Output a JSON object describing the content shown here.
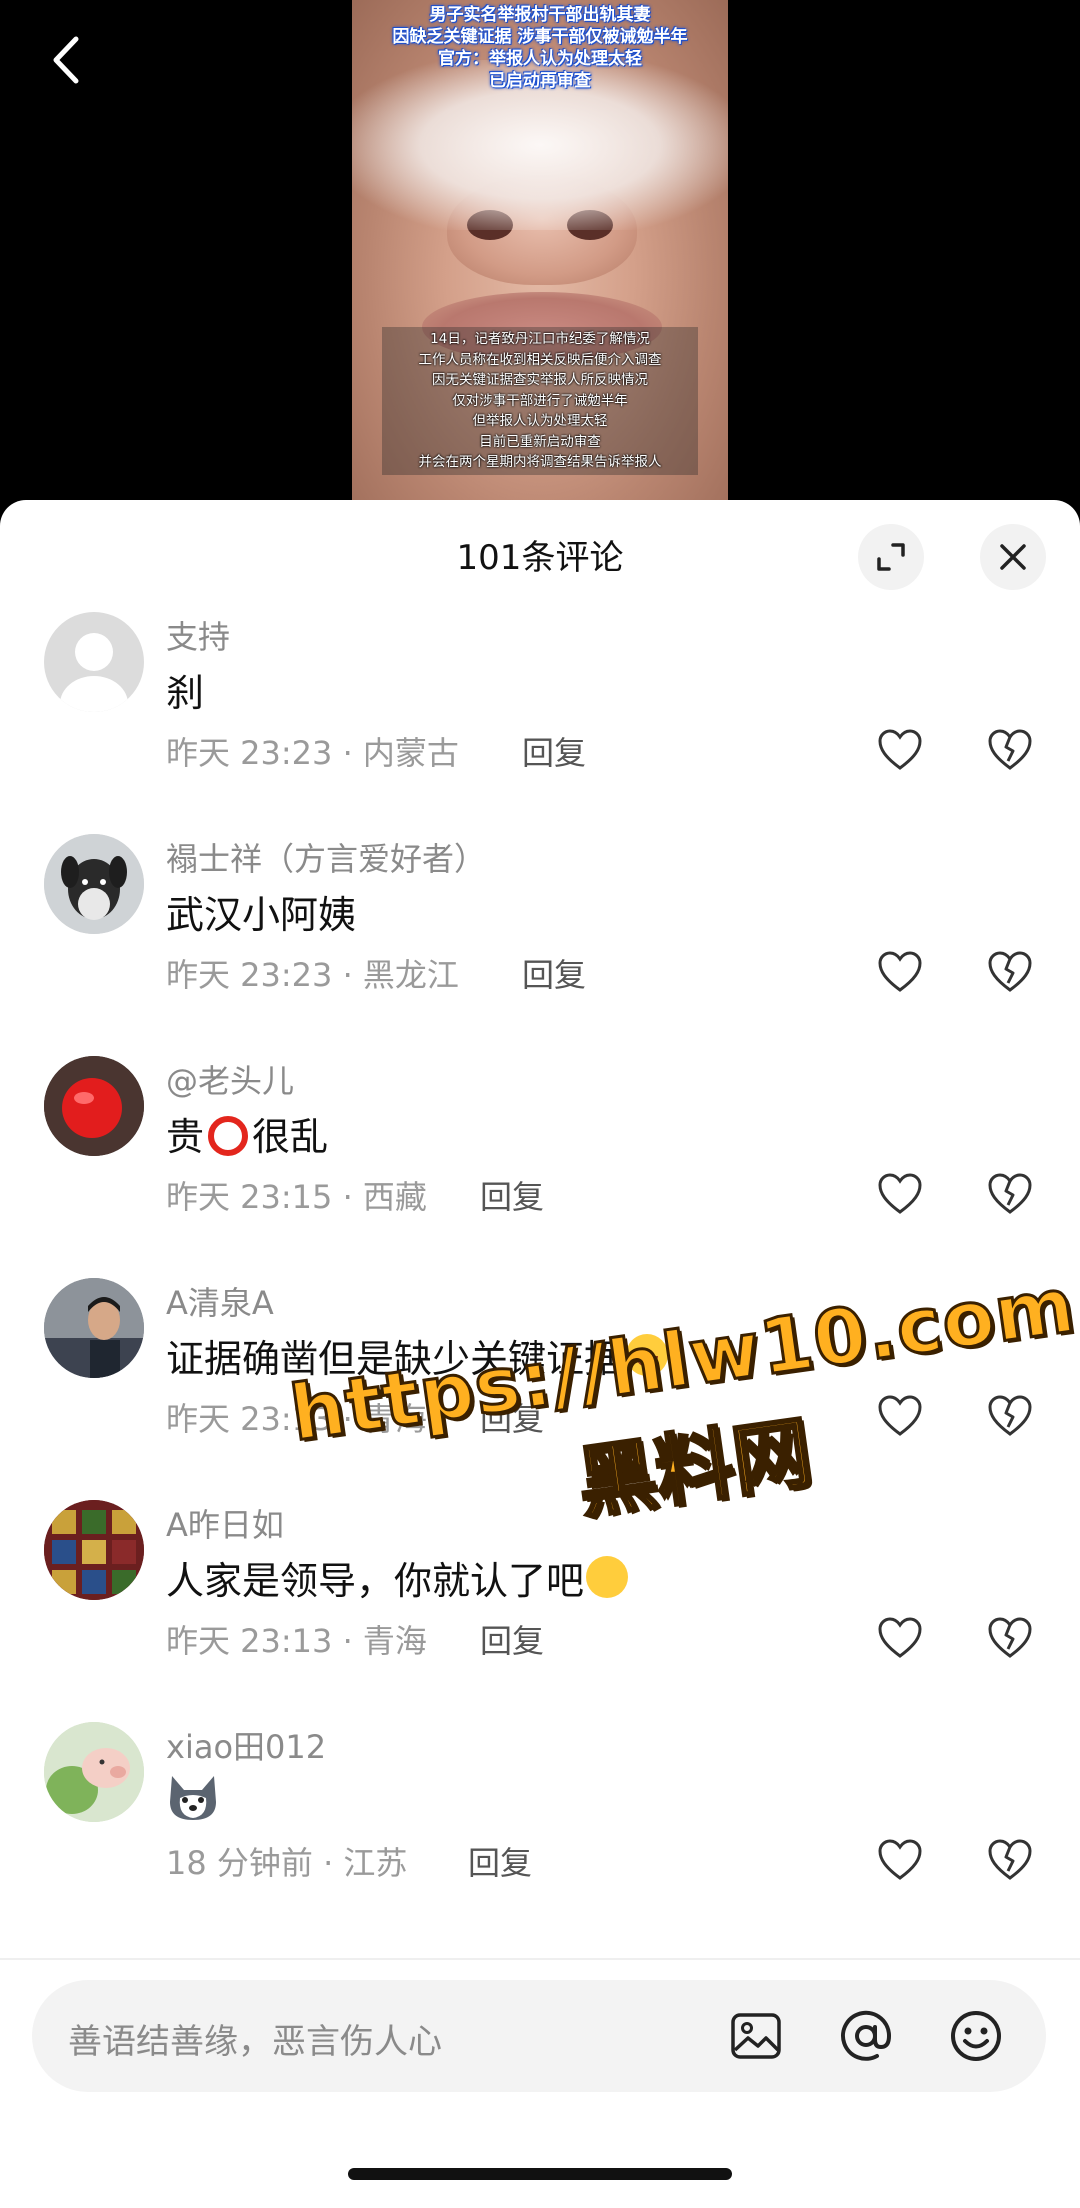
{
  "video": {
    "headline": [
      "男子实名举报村干部出轨其妻",
      "因缺乏关键证据 涉事干部仅被诫勉半年",
      "官方：举报人认为处理太轻",
      "已启动再审查"
    ],
    "caption": [
      "14日，记者致丹江口市纪委了解情况",
      "工作人员称在收到相关反映后便介入调查",
      "因无关键证据查实举报人所反映情况",
      "仅对涉事干部进行了诫勉半年",
      "但举报人认为处理太轻",
      "目前已重新启动审查",
      "并会在两个星期内将调查结果告诉举报人"
    ]
  },
  "sheet": {
    "title": "101条评论",
    "reply_label": "回复"
  },
  "comments": [
    {
      "name": "支持",
      "text": "刹",
      "meta": "昨天 23:23 · 内蒙古"
    },
    {
      "name": "褟士祥（方言爱好者）",
      "text": "武汉小阿姨",
      "meta": "昨天 23:23 · 黑龙江"
    },
    {
      "name": "@老头儿",
      "text_before": "贵",
      "text_after": "很乱",
      "meta": "昨天 23:15 · 西藏"
    },
    {
      "name": "A清泉A",
      "text": "证据确凿但是缺少关键证据",
      "meta": "昨天 23:13 · 青海"
    },
    {
      "name": "A昨日如",
      "text": "人家是领导，你就认了吧",
      "meta": "昨天 23:13 · 青海"
    },
    {
      "name": "xiao田012",
      "text": "",
      "meta": "18 分钟前 · 江苏"
    }
  ],
  "input": {
    "placeholder": "善语结善缘，恶言伤人心"
  },
  "icons": {
    "back": "chevron-left-icon",
    "expand": "expand-icon",
    "close": "close-icon",
    "like": "heart-icon",
    "dislike": "broken-heart-icon",
    "image": "image-icon",
    "mention": "at-icon",
    "emoji": "smiley-icon"
  },
  "watermark": {
    "url": "https://hlw10.com",
    "name": "黑料网"
  }
}
